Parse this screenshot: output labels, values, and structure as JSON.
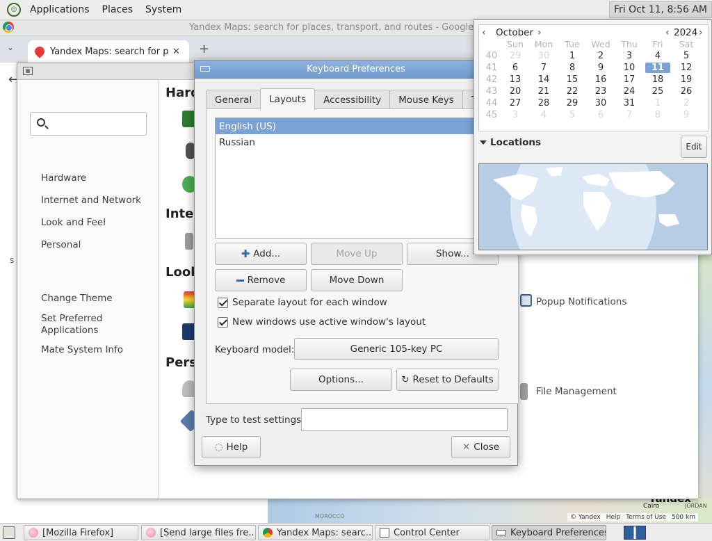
{
  "top_panel": {
    "menus": [
      "Applications",
      "Places",
      "System"
    ],
    "clock": "Fri Oct 11,  8:56 AM"
  },
  "chrome": {
    "window_title": "Yandex Maps: search for places, transport, and routes - Google Chr",
    "tab_title": "Yandex Maps: search for places, transport, and routes",
    "map_footer": [
      "© Yandex",
      "Help",
      "Terms of Use",
      "500 km"
    ],
    "map_labels": [
      "Yandex",
      "Cairo",
      "JORDAN",
      "MOROCCO"
    ]
  },
  "control_center": {
    "sidebar_groups": [
      "Hardware",
      "Internet and Network",
      "Look and Feel",
      "Personal"
    ],
    "sidebar_tasks": [
      "Change Theme",
      "Set Preferred Applications",
      "Mate System Info"
    ],
    "section_headings": [
      "Hard",
      "Inter",
      "Look",
      "Perso"
    ],
    "visible_items": [
      "Popup Notifications",
      "File Management"
    ]
  },
  "keyboard_dialog": {
    "title": "Keyboard Preferences",
    "tabs": [
      "General",
      "Layouts",
      "Accessibility",
      "Mouse Keys",
      "Typing"
    ],
    "active_tab": "Layouts",
    "layouts": [
      "English (US)",
      "Russian"
    ],
    "buttons": {
      "add": "Add...",
      "move_up": "Move Up",
      "show": "Show...",
      "remove": "Remove",
      "move_down": "Move Down",
      "options": "Options...",
      "reset": "Reset to Defaults",
      "help": "Help",
      "close": "Close"
    },
    "checkboxes": {
      "separate_layout": "Separate layout for each window",
      "new_windows": "New windows use active window's layout"
    },
    "keyboard_model_label": "Keyboard model:",
    "keyboard_model_value": "Generic 105-key PC",
    "test_label": "Type to test settings:",
    "test_value": ""
  },
  "calendar": {
    "month": "October",
    "year": "2024",
    "weekdays": [
      "Sun",
      "Mon",
      "Tue",
      "Wed",
      "Thu",
      "Fri",
      "Sat"
    ],
    "weeks": [
      {
        "num": "40",
        "days": [
          "29",
          "30",
          "1",
          "2",
          "3",
          "4",
          "5"
        ],
        "other": [
          0,
          1
        ]
      },
      {
        "num": "41",
        "days": [
          "6",
          "7",
          "8",
          "9",
          "10",
          "11",
          "12"
        ],
        "other": []
      },
      {
        "num": "42",
        "days": [
          "13",
          "14",
          "15",
          "16",
          "17",
          "18",
          "19"
        ],
        "other": []
      },
      {
        "num": "43",
        "days": [
          "20",
          "21",
          "22",
          "23",
          "24",
          "25",
          "26"
        ],
        "other": []
      },
      {
        "num": "44",
        "days": [
          "27",
          "28",
          "29",
          "30",
          "31",
          "1",
          "2"
        ],
        "other": [
          5,
          6
        ]
      },
      {
        "num": "45",
        "days": [
          "3",
          "4",
          "5",
          "6",
          "7",
          "8",
          "9"
        ],
        "other": [
          0,
          1,
          2,
          3,
          4,
          5,
          6
        ]
      }
    ],
    "today": "11",
    "locations_label": "Locations",
    "edit_label": "Edit"
  },
  "taskbar": {
    "tasks": [
      "[Mozilla Firefox]",
      "[Send large files fre...",
      "Yandex Maps: searc...",
      "Control Center",
      "Keyboard Preferences"
    ]
  }
}
